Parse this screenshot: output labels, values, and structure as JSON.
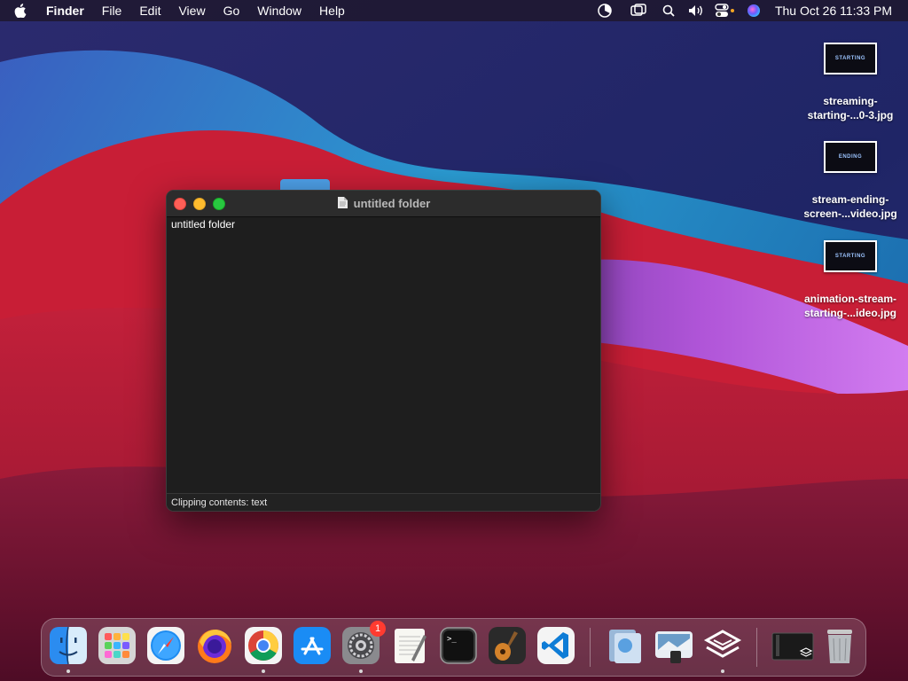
{
  "menubar": {
    "app_name": "Finder",
    "menus": [
      "File",
      "Edit",
      "View",
      "Go",
      "Window",
      "Help"
    ],
    "status_icons": [
      "screen-time-icon",
      "screen-mirroring-icon",
      "spotlight-search-icon",
      "volume-icon",
      "control-center-icon",
      "siri-icon"
    ],
    "clock": "Thu Oct 26  11:33 PM"
  },
  "desktop": {
    "items": [
      {
        "thumb_text": "STARTING",
        "label_line1": "streaming-",
        "label_line2": "starting-...0-3.jpg"
      },
      {
        "thumb_text": "ENDING",
        "label_line1": "stream-ending-",
        "label_line2": "screen-...video.jpg"
      },
      {
        "thumb_text": "STARTING",
        "label_line1": "animation-stream-",
        "label_line2": "starting-...ideo.jpg"
      }
    ]
  },
  "window": {
    "title": "untitled folder",
    "content_text": "untitled folder",
    "status_text": "Clipping contents: text"
  },
  "dock": {
    "apps": [
      "Finder",
      "Launchpad",
      "Safari",
      "Firefox",
      "Google Chrome",
      "App Store",
      "System Preferences",
      "TextEdit",
      "Terminal",
      "GarageBand",
      "Visual Studio Code",
      "Preview",
      "Image Capture",
      "Lines App",
      "Screenshot Stack",
      "Trash"
    ],
    "notification_badge": "1"
  },
  "colors": {
    "accent_red": "#ff5f57",
    "accent_yellow": "#febc2e",
    "accent_green": "#28c840",
    "window_bg": "#1e1e1e",
    "badge_red": "#ff3b30"
  }
}
